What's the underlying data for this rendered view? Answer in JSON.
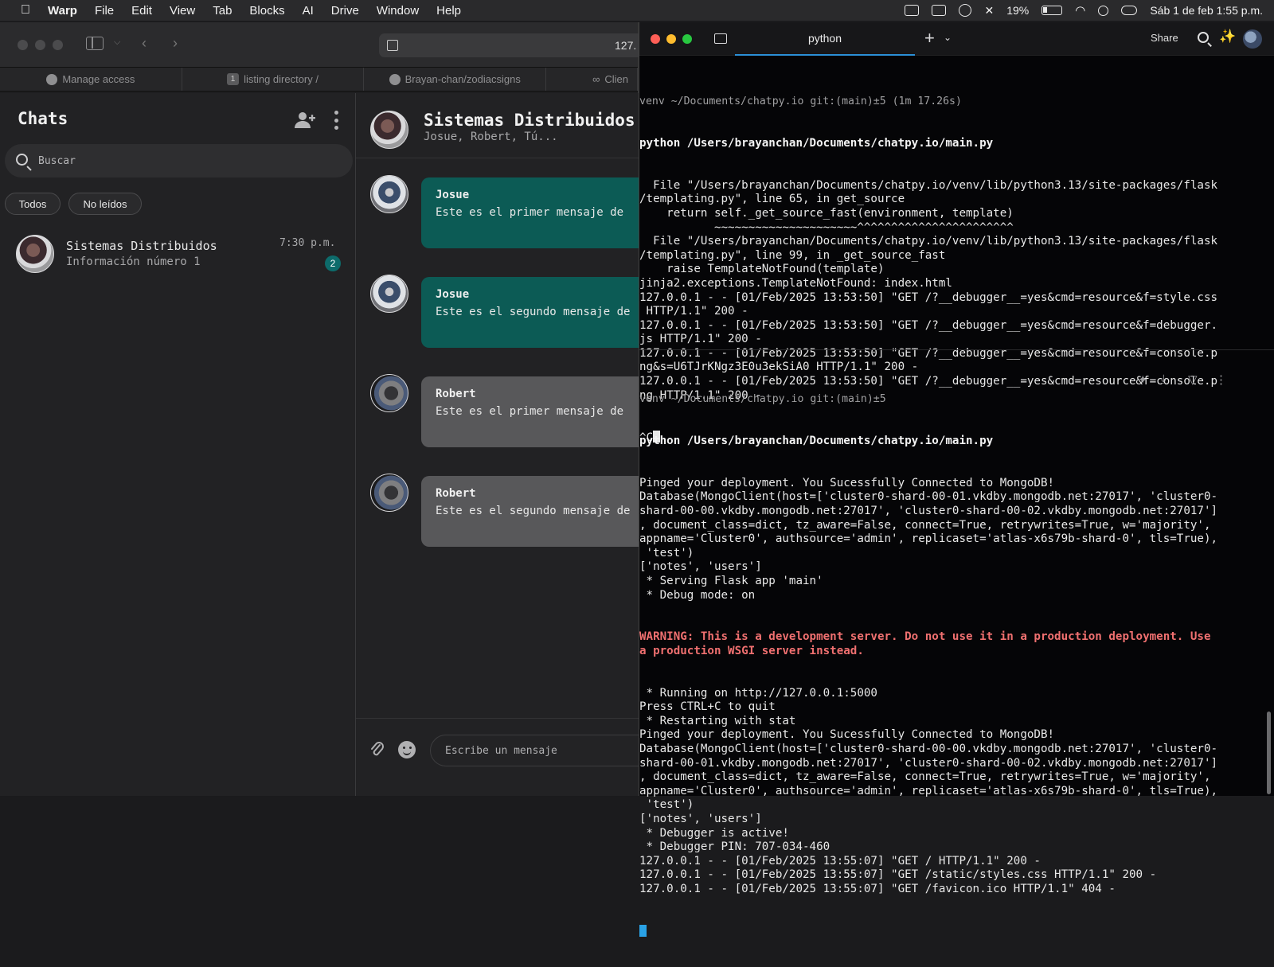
{
  "menubar": {
    "app": "Warp",
    "items": [
      "File",
      "Edit",
      "View",
      "Tab",
      "Blocks",
      "AI",
      "Drive",
      "Window",
      "Help"
    ],
    "battery": "19%",
    "datetime": "Sáb 1 de feb  1:55 p.m."
  },
  "browser": {
    "url": "127.",
    "tabs": [
      {
        "label": "Manage access",
        "icon": "github-icon"
      },
      {
        "label": "listing directory /",
        "icon": "number-badge-icon",
        "num": "1"
      },
      {
        "label": "Brayan-chan/zodiacsigns",
        "icon": "github-icon"
      },
      {
        "label": "Clien",
        "icon": "link-icon"
      }
    ]
  },
  "chatlist": {
    "title": "Chats",
    "search_placeholder": "Buscar",
    "filters": [
      "Todos",
      "No leídos"
    ],
    "conversations": [
      {
        "name": "Sistemas Distribuidos",
        "preview": "Información número 1",
        "time": "7:30 p.m.",
        "unread": "2"
      }
    ]
  },
  "chat": {
    "title": "Sistemas Distribuidos",
    "members": "Josue, Robert, Tú...",
    "messages": [
      {
        "sender": "Josue",
        "text": "Este es el primer mensaje de",
        "style": "teal"
      },
      {
        "sender": "Josue",
        "text": "Este es el segundo mensaje de",
        "style": "teal"
      },
      {
        "sender": "Robert",
        "text": "Este es el primer mensaje de",
        "style": "gray"
      },
      {
        "sender": "Robert",
        "text": "Este es el segundo mensaje de",
        "style": "gray"
      }
    ],
    "composer_placeholder": "Escribe un mensaje"
  },
  "terminal": {
    "tab_title": "python",
    "share_label": "Share",
    "block1": {
      "meta": "venv ~/Documents/chatpy.io git:(main)±5 (1m 17.26s)",
      "command": "python /Users/brayanchan/Documents/chatpy.io/main.py",
      "output": [
        "  File \"/Users/brayanchan/Documents/chatpy.io/venv/lib/python3.13/site-packages/flask",
        "/templating.py\", line 65, in get_source",
        "    return self._get_source_fast(environment, template)",
        "           ~~~~~~~~~~~~~~~~~~~~~^^^^^^^^^^^^^^^^^^^^^^^",
        "  File \"/Users/brayanchan/Documents/chatpy.io/venv/lib/python3.13/site-packages/flask",
        "/templating.py\", line 99, in _get_source_fast",
        "    raise TemplateNotFound(template)",
        "jinja2.exceptions.TemplateNotFound: index.html",
        "127.0.0.1 - - [01/Feb/2025 13:53:50] \"GET /?__debugger__=yes&cmd=resource&f=style.css",
        " HTTP/1.1\" 200 -",
        "127.0.0.1 - - [01/Feb/2025 13:53:50] \"GET /?__debugger__=yes&cmd=resource&f=debugger.",
        "js HTTP/1.1\" 200 -",
        "127.0.0.1 - - [01/Feb/2025 13:53:50] \"GET /?__debugger__=yes&cmd=resource&f=console.p",
        "ng&s=U6TJrKNgz3E0u3ekSiA0 HTTP/1.1\" 200 -",
        "127.0.0.1 - - [01/Feb/2025 13:53:50] \"GET /?__debugger__=yes&cmd=resource&f=console.p",
        "ng HTTP/1.1\" 200 -"
      ],
      "interrupt": "^C"
    },
    "block2": {
      "meta": "venv ~/Documents/chatpy.io git:(main)±5",
      "command": "python /Users/brayanchan/Documents/chatpy.io/main.py",
      "output_pre": [
        "Pinged your deployment. You Sucessfully Connected to MongoDB!",
        "Database(MongoClient(host=['cluster0-shard-00-01.vkdby.mongodb.net:27017', 'cluster0-",
        "shard-00-00.vkdby.mongodb.net:27017', 'cluster0-shard-00-02.vkdby.mongodb.net:27017']",
        ", document_class=dict, tz_aware=False, connect=True, retrywrites=True, w='majority',",
        "appname='Cluster0', authsource='admin', replicaset='atlas-x6s79b-shard-0', tls=True),",
        " 'test')",
        "['notes', 'users']",
        " * Serving Flask app 'main'",
        " * Debug mode: on"
      ],
      "warning": [
        "WARNING: This is a development server. Do not use it in a production deployment. Use",
        "a production WSGI server instead."
      ],
      "output_post": [
        " * Running on http://127.0.0.1:5000",
        "Press CTRL+C to quit",
        " * Restarting with stat",
        "Pinged your deployment. You Sucessfully Connected to MongoDB!",
        "Database(MongoClient(host=['cluster0-shard-00-00.vkdby.mongodb.net:27017', 'cluster0-",
        "shard-00-01.vkdby.mongodb.net:27017', 'cluster0-shard-00-02.vkdby.mongodb.net:27017']",
        ", document_class=dict, tz_aware=False, connect=True, retrywrites=True, w='majority',",
        "appname='Cluster0', authsource='admin', replicaset='atlas-x6s79b-shard-0', tls=True),",
        " 'test')",
        "['notes', 'users']",
        " * Debugger is active!",
        " * Debugger PIN: 707-034-460",
        "127.0.0.1 - - [01/Feb/2025 13:55:07] \"GET / HTTP/1.1\" 200 -",
        "127.0.0.1 - - [01/Feb/2025 13:55:07] \"GET /static/styles.css HTTP/1.1\" 200 -",
        "127.0.0.1 - - [01/Feb/2025 13:55:07] \"GET /favicon.ico HTTP/1.1\" 404 -"
      ]
    }
  }
}
